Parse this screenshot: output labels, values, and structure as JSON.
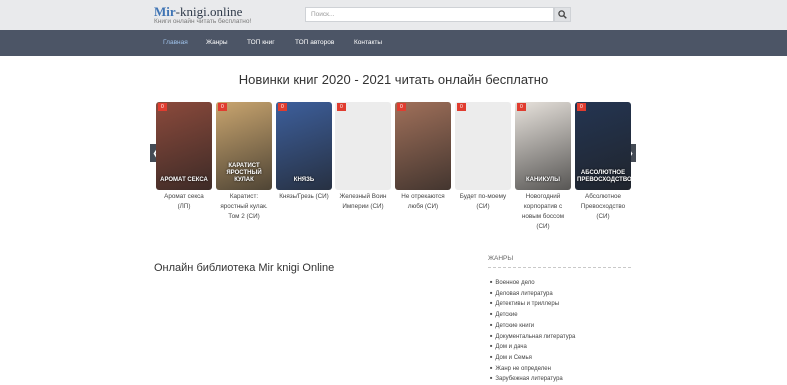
{
  "header": {
    "logo_highlight": "Mir",
    "logo_rest": "-knigi.online",
    "tagline": "Книги онлайн читать бесплатно!",
    "search_placeholder": "Поиск..."
  },
  "nav": {
    "items": [
      {
        "label": "Главная",
        "active": true
      },
      {
        "label": "Жанры",
        "active": false
      },
      {
        "label": "ТОП книг",
        "active": false
      },
      {
        "label": "ТОП авторов",
        "active": false
      },
      {
        "label": "Контакты",
        "active": false
      }
    ]
  },
  "main": {
    "heading": "Новинки книг 2020 - 2021 читать онлайн бесплатно",
    "library_title": "Онлайн библиотека Mir knigi Online"
  },
  "carousel": {
    "prev_icon": "chevron-left-icon",
    "next_icon": "chevron-right-icon",
    "books": [
      {
        "badge": "0",
        "title": [
          "Аромат секса",
          "(ЛП)"
        ],
        "cover_text": "АРОМАТ СЕКСА",
        "color": "#8b4a3c"
      },
      {
        "badge": "0",
        "title": [
          "Каратист:",
          "яростный кулак.",
          "Том 2 (СИ)"
        ],
        "cover_text": "КАРАТИСТ ЯРОСТНЫЙ КУЛАК",
        "color": "#c9a56f"
      },
      {
        "badge": "0",
        "title": [
          "Князь/Грезь (СИ)"
        ],
        "cover_text": "КНЯЗЬ",
        "color": "#3d5f9c"
      },
      {
        "badge": "0",
        "title": [
          "Железный Воин",
          "Империи (СИ)"
        ],
        "cover_text": "",
        "color": "#ececec"
      },
      {
        "badge": "0",
        "title": [
          "Не отрекаются",
          "любя (СИ)"
        ],
        "cover_text": "",
        "color": "#a0705a"
      },
      {
        "badge": "0",
        "title": [
          "Будет по-моему",
          "(СИ)"
        ],
        "cover_text": "",
        "color": "#ececec"
      },
      {
        "badge": "0",
        "title": [
          "Новогодний",
          "корпоратив с",
          "новым боссом",
          "(СИ)"
        ],
        "cover_text": "КАНИКУЛЫ",
        "color": "#e7e2dc"
      },
      {
        "badge": "0",
        "title": [
          "Абсолютное",
          "Превосходство",
          "(СИ)"
        ],
        "cover_text": "АБСОЛЮТНОЕ ПРЕВОСХОДСТВО",
        "color": "#243552"
      }
    ]
  },
  "sidebar": {
    "genres_title": "ЖАНРЫ",
    "genres": [
      "Военное дело",
      "Деловая литература",
      "Детективы и триллеры",
      "Детские",
      "Детские книги",
      "Документальная литература",
      "Дом и дача",
      "Дом и Семья",
      "Жанр не определен",
      "Зарубежная литература"
    ]
  }
}
